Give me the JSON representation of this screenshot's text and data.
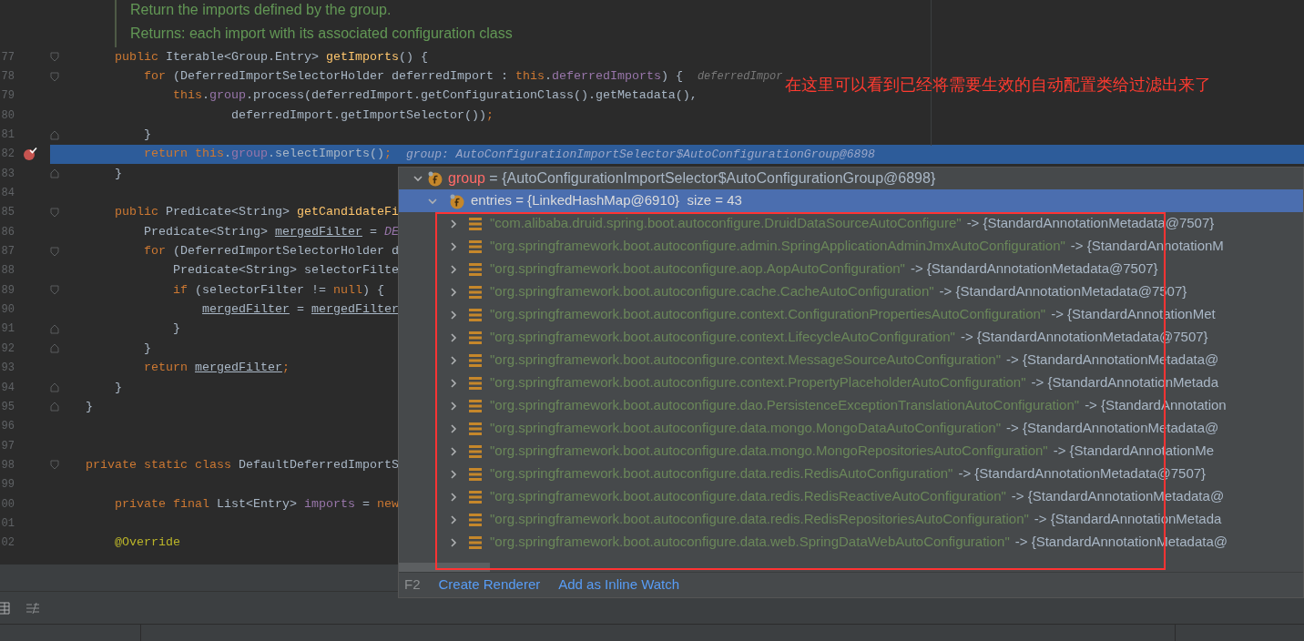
{
  "doc_comment": {
    "lines": [
      "Return the imports defined by the group.",
      "Returns: each import with its associated configuration class"
    ]
  },
  "editor": {
    "lines": [
      {
        "number": "77",
        "fold_start": true,
        "fold_end": false,
        "breakpoint": false,
        "highlighted": false,
        "tokens": [
          {
            "kind": "keyword",
            "text": "    public "
          },
          {
            "kind": "plain",
            "text": "Iterable<Group.Entry> "
          },
          {
            "kind": "method",
            "text": "getImports"
          },
          {
            "kind": "plain",
            "text": "() {"
          }
        ]
      },
      {
        "number": "78",
        "fold_start": true,
        "fold_end": false,
        "breakpoint": false,
        "highlighted": false,
        "tokens": [
          {
            "kind": "keyword",
            "text": "        for "
          },
          {
            "kind": "plain",
            "text": "(DeferredImportSelectorHolder deferredImport : "
          },
          {
            "kind": "keyword",
            "text": "this"
          },
          {
            "kind": "plain",
            "text": "."
          },
          {
            "kind": "field",
            "text": "deferredImports"
          },
          {
            "kind": "plain",
            "text": ") {"
          }
        ],
        "hint": "deferredImpor"
      },
      {
        "number": "79",
        "fold_start": false,
        "fold_end": false,
        "breakpoint": false,
        "highlighted": false,
        "tokens": [
          {
            "kind": "keyword",
            "text": "            this"
          },
          {
            "kind": "plain",
            "text": "."
          },
          {
            "kind": "field",
            "text": "group"
          },
          {
            "kind": "plain",
            "text": ".process(deferredImport.getConfigurationClass().getMetadata(),"
          }
        ]
      },
      {
        "number": "80",
        "fold_start": false,
        "fold_end": false,
        "breakpoint": false,
        "highlighted": false,
        "tokens": [
          {
            "kind": "plain",
            "text": "                    deferredImport.getImportSelector())"
          },
          {
            "kind": "keyword",
            "text": ";"
          }
        ]
      },
      {
        "number": "81",
        "fold_start": false,
        "fold_end": true,
        "breakpoint": false,
        "highlighted": false,
        "tokens": [
          {
            "kind": "plain",
            "text": "        }"
          }
        ]
      },
      {
        "number": "82",
        "fold_start": false,
        "fold_end": false,
        "breakpoint": true,
        "highlighted": true,
        "tokens": [
          {
            "kind": "keyword",
            "text": "        return "
          },
          {
            "kind": "keyword",
            "text": "this"
          },
          {
            "kind": "plain",
            "text": "."
          },
          {
            "kind": "field",
            "text": "group"
          },
          {
            "kind": "plain",
            "text": ".selectImports()"
          },
          {
            "kind": "keyword",
            "text": ";"
          }
        ],
        "hint": "group: AutoConfigurationImportSelector$AutoConfigurationGroup@6898"
      },
      {
        "number": "83",
        "fold_start": false,
        "fold_end": true,
        "breakpoint": false,
        "highlighted": false,
        "tokens": [
          {
            "kind": "plain",
            "text": "    }"
          }
        ]
      },
      {
        "number": "84",
        "fold_start": false,
        "fold_end": false,
        "breakpoint": false,
        "highlighted": false
      },
      {
        "number": "85",
        "fold_start": true,
        "fold_end": false,
        "breakpoint": false,
        "highlighted": false,
        "tokens": [
          {
            "kind": "keyword",
            "text": "    public "
          },
          {
            "kind": "plain",
            "text": "Predicate<String> "
          },
          {
            "kind": "method",
            "text": "getCandidateFi"
          }
        ]
      },
      {
        "number": "86",
        "fold_start": false,
        "fold_end": false,
        "breakpoint": false,
        "highlighted": false,
        "tokens": [
          {
            "kind": "plain",
            "text": "        Predicate<String> "
          },
          {
            "kind": "local",
            "text": "mergedFilter"
          },
          {
            "kind": "plain",
            "text": " = "
          },
          {
            "kind": "constant",
            "text": "DE"
          }
        ]
      },
      {
        "number": "87",
        "fold_start": true,
        "fold_end": false,
        "breakpoint": false,
        "highlighted": false,
        "tokens": [
          {
            "kind": "keyword",
            "text": "        for "
          },
          {
            "kind": "plain",
            "text": "(DeferredImportSelectorHolder d"
          }
        ]
      },
      {
        "number": "88",
        "fold_start": false,
        "fold_end": false,
        "breakpoint": false,
        "highlighted": false,
        "tokens": [
          {
            "kind": "plain",
            "text": "            Predicate<String> selectorFilte"
          }
        ]
      },
      {
        "number": "89",
        "fold_start": true,
        "fold_end": false,
        "breakpoint": false,
        "highlighted": false,
        "tokens": [
          {
            "kind": "keyword",
            "text": "            if "
          },
          {
            "kind": "plain",
            "text": "(selectorFilter != "
          },
          {
            "kind": "keyword",
            "text": "null"
          },
          {
            "kind": "plain",
            "text": ") {"
          }
        ]
      },
      {
        "number": "90",
        "fold_start": false,
        "fold_end": false,
        "breakpoint": false,
        "highlighted": false,
        "tokens": [
          {
            "kind": "local",
            "text": "                mergedFilter"
          },
          {
            "kind": "plain",
            "text": " = "
          },
          {
            "kind": "local",
            "text": "mergedFilter"
          }
        ]
      },
      {
        "number": "91",
        "fold_start": false,
        "fold_end": true,
        "breakpoint": false,
        "highlighted": false,
        "tokens": [
          {
            "kind": "plain",
            "text": "            }"
          }
        ]
      },
      {
        "number": "92",
        "fold_start": false,
        "fold_end": true,
        "breakpoint": false,
        "highlighted": false,
        "tokens": [
          {
            "kind": "plain",
            "text": "        }"
          }
        ]
      },
      {
        "number": "93",
        "fold_start": false,
        "fold_end": false,
        "breakpoint": false,
        "highlighted": false,
        "tokens": [
          {
            "kind": "keyword",
            "text": "        return "
          },
          {
            "kind": "local",
            "text": "mergedFilter"
          },
          {
            "kind": "keyword",
            "text": ";"
          }
        ]
      },
      {
        "number": "94",
        "fold_start": false,
        "fold_end": true,
        "breakpoint": false,
        "highlighted": false,
        "tokens": [
          {
            "kind": "plain",
            "text": "    }"
          }
        ]
      },
      {
        "number": "95",
        "fold_start": false,
        "fold_end": true,
        "breakpoint": false,
        "highlighted": false,
        "tokens": [
          {
            "kind": "plain",
            "text": "}"
          }
        ]
      },
      {
        "number": "96",
        "fold_start": false,
        "fold_end": false,
        "breakpoint": false,
        "highlighted": false
      },
      {
        "number": "97",
        "fold_start": false,
        "fold_end": false,
        "breakpoint": false,
        "highlighted": false
      },
      {
        "number": "98",
        "fold_start": true,
        "fold_end": false,
        "breakpoint": false,
        "highlighted": false,
        "tokens": [
          {
            "kind": "keyword",
            "text": "private static class "
          },
          {
            "kind": "plain",
            "text": "DefaultDeferredImportS"
          }
        ]
      },
      {
        "number": "99",
        "fold_start": false,
        "fold_end": false,
        "breakpoint": false,
        "highlighted": false
      },
      {
        "number": "00",
        "fold_start": false,
        "fold_end": false,
        "breakpoint": false,
        "highlighted": false,
        "tokens": [
          {
            "kind": "keyword",
            "text": "    private final "
          },
          {
            "kind": "plain",
            "text": "List<Entry> "
          },
          {
            "kind": "field",
            "text": "imports"
          },
          {
            "kind": "plain",
            "text": " = "
          },
          {
            "kind": "keyword",
            "text": "new"
          }
        ]
      },
      {
        "number": "01",
        "fold_start": false,
        "fold_end": false,
        "breakpoint": false,
        "highlighted": false
      },
      {
        "number": "02",
        "fold_start": false,
        "fold_end": false,
        "breakpoint": false,
        "highlighted": false,
        "tokens": [
          {
            "kind": "annotation",
            "text": "    @Override"
          }
        ]
      }
    ]
  },
  "annotation": {
    "text": "在这里可以看到已经将需要生效的自动配置类给过滤出来了"
  },
  "debug_popup": {
    "group": {
      "name": "group",
      "value": " = {AutoConfigurationImportSelector$AutoConfigurationGroup@6898}",
      "expanded": true,
      "selected": false
    },
    "entries": {
      "text": "entries = {LinkedHashMap@6910}  size = 43",
      "expanded": true,
      "selected": true
    },
    "items": [
      {
        "key": "\"com.alibaba.druid.spring.boot.autoconfigure.DruidDataSourceAutoConfigure\"",
        "value": "-> {StandardAnnotationMetadata@7507}",
        "expanded": false
      },
      {
        "key": "\"org.springframework.boot.autoconfigure.admin.SpringApplicationAdminJmxAutoConfiguration\"",
        "value": "-> {StandardAnnotationM",
        "expanded": false
      },
      {
        "key": "\"org.springframework.boot.autoconfigure.aop.AopAutoConfiguration\"",
        "value": "-> {StandardAnnotationMetadata@7507}",
        "expanded": false
      },
      {
        "key": "\"org.springframework.boot.autoconfigure.cache.CacheAutoConfiguration\"",
        "value": "-> {StandardAnnotationMetadata@7507}",
        "expanded": false
      },
      {
        "key": "\"org.springframework.boot.autoconfigure.context.ConfigurationPropertiesAutoConfiguration\"",
        "value": "-> {StandardAnnotationMet",
        "expanded": false
      },
      {
        "key": "\"org.springframework.boot.autoconfigure.context.LifecycleAutoConfiguration\"",
        "value": "-> {StandardAnnotationMetadata@7507}",
        "expanded": false
      },
      {
        "key": "\"org.springframework.boot.autoconfigure.context.MessageSourceAutoConfiguration\"",
        "value": "-> {StandardAnnotationMetadata@",
        "expanded": false
      },
      {
        "key": "\"org.springframework.boot.autoconfigure.context.PropertyPlaceholderAutoConfiguration\"",
        "value": "-> {StandardAnnotationMetada",
        "expanded": false
      },
      {
        "key": "\"org.springframework.boot.autoconfigure.dao.PersistenceExceptionTranslationAutoConfiguration\"",
        "value": "-> {StandardAnnotation",
        "expanded": false
      },
      {
        "key": "\"org.springframework.boot.autoconfigure.data.mongo.MongoDataAutoConfiguration\"",
        "value": "-> {StandardAnnotationMetadata@",
        "expanded": false
      },
      {
        "key": "\"org.springframework.boot.autoconfigure.data.mongo.MongoRepositoriesAutoConfiguration\"",
        "value": "-> {StandardAnnotationMe",
        "expanded": false
      },
      {
        "key": "\"org.springframework.boot.autoconfigure.data.redis.RedisAutoConfiguration\"",
        "value": "-> {StandardAnnotationMetadata@7507}",
        "expanded": false
      },
      {
        "key": "\"org.springframework.boot.autoconfigure.data.redis.RedisReactiveAutoConfiguration\"",
        "value": "-> {StandardAnnotationMetadata@",
        "expanded": false
      },
      {
        "key": "\"org.springframework.boot.autoconfigure.data.redis.RedisRepositoriesAutoConfiguration\"",
        "value": "-> {StandardAnnotationMetada",
        "expanded": false
      },
      {
        "key": "\"org.springframework.boot.autoconfigure.data.web.SpringDataWebAutoConfiguration\"",
        "value": "-> {StandardAnnotationMetadata@",
        "expanded": false
      }
    ],
    "footer": {
      "shortcut": "F2",
      "links": [
        "Create Renderer",
        "Add as Inline Watch"
      ]
    }
  }
}
